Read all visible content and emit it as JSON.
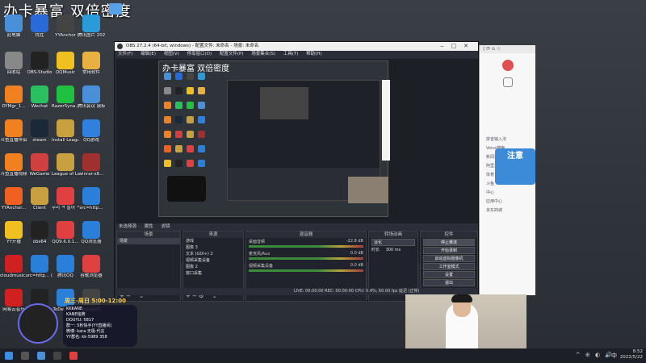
{
  "banner": {
    "text": "办卡暴富 双倍密度"
  },
  "desktop_icons": [
    {
      "label": "此电脑",
      "color": "#4a90d9"
    },
    {
      "label": "找茬",
      "color": "#2a6ad8"
    },
    {
      "label": "YYAnchor",
      "color": "#444"
    },
    {
      "label": "腾讯图片 2022051...",
      "color": "#2a9ad8"
    },
    {
      "label": "回收站",
      "color": "#888"
    },
    {
      "label": "OBS-Studio",
      "color": "#222"
    },
    {
      "label": "QQMusic",
      "color": "#f0c020"
    },
    {
      "label": "常用软件",
      "color": "#e8b040"
    },
    {
      "label": "DYMgr_1...",
      "color": "#f08020"
    },
    {
      "label": "Wechat",
      "color": "#2ac060"
    },
    {
      "label": "RazerSyna...",
      "color": "#20c040"
    },
    {
      "label": "腾讯会议 鼠标点击",
      "color": "#4a90d9"
    },
    {
      "label": "斗鱼直播伴侣",
      "color": "#f08020"
    },
    {
      "label": "steam",
      "color": "#1b2838"
    },
    {
      "label": "Install League...",
      "color": "#c8a040"
    },
    {
      "label": "QQ游戏",
      "color": "#3080e0"
    },
    {
      "label": "斗鱼直播视频",
      "color": "#f08020"
    },
    {
      "label": "WeGame",
      "color": "#d04040"
    },
    {
      "label": "League of Legends",
      "color": "#c8a040"
    },
    {
      "label": "winrar-x6...",
      "color": "#a03030"
    },
    {
      "label": "YYAnchor...",
      "color": "#f06020"
    },
    {
      "label": "Client",
      "color": "#c8a040"
    },
    {
      "label": "우리 ㅋ 들어 ㅋ",
      "color": "#e04040"
    },
    {
      "label": "src=http...",
      "color": "#2a80d8"
    },
    {
      "label": "YY开播",
      "color": "#f0c020"
    },
    {
      "label": "obs64",
      "color": "#222"
    },
    {
      "label": "QQ9.6.0.1...",
      "color": "#e04040"
    },
    {
      "label": "QQ浏览器",
      "color": "#2a80d8"
    },
    {
      "label": "cloudmusic...",
      "color": "#d02020"
    },
    {
      "label": "src=http... (1)",
      "color": "#2a80d8"
    },
    {
      "label": "腾讯QQ",
      "color": "#2a80d8"
    },
    {
      "label": "谷歌浏览器",
      "color": "#e04040"
    },
    {
      "label": "网易云音乐",
      "color": "#d02020"
    },
    {
      "label": "OBS Studio",
      "color": "#222"
    },
    {
      "label": "ToDesk_5...",
      "color": "#2a80d8"
    },
    {
      "label": "kara铭牌",
      "color": "#444"
    }
  ],
  "obs": {
    "title": "OBS 27.2.4 (64-bit, windows) - 配置文件: 未命名 - 场景: 未命名",
    "menu": [
      "文件(F)",
      "编辑(E)",
      "视图(V)",
      "停靠窗口(D)",
      "配置文件(P)",
      "场景集合(S)",
      "工具(T)",
      "帮助(H)"
    ],
    "source_label": "未选择源",
    "properties_label": "属性",
    "filters_label": "滤镜",
    "docks": {
      "scenes": {
        "title": "场景",
        "items": [
          "场景"
        ]
      },
      "sources": {
        "title": "来源",
        "items": [
          "游戏",
          "图像 3",
          "文本 (GDI+) 2",
          "视频采集设备",
          "图像 2",
          "窗口采集"
        ]
      },
      "mixer": {
        "title": "混音器",
        "rows": [
          {
            "name": "桌面音频",
            "db": "-22.8 dB"
          },
          {
            "name": "麦克风/Aux",
            "db": "0.0 dB"
          },
          {
            "name": "视频采集设备",
            "db": "0.0 dB"
          }
        ]
      },
      "transitions": {
        "title": "转场动画",
        "type": "淡化",
        "duration_label": "时长",
        "duration": "300 ms"
      },
      "controls": {
        "title": "控件",
        "buttons": [
          "停止推流",
          "开始录制",
          "启动虚拟摄像机",
          "工作室模式",
          "设置",
          "退出"
        ]
      }
    },
    "status": "LIVE: 00:00:00   REC: 00:00:00   CPU: 0.4%, 60.00 fps   延迟 (正常)"
  },
  "browser": {
    "items": [
      "拼音输入法",
      "Voice搜索",
      "新闻资讯",
      "阿里云",
      "体育",
      "斗鱼",
      "中心",
      "应用中心",
      "京东商城"
    ],
    "assist_text": "注意"
  },
  "overlay": {
    "live_text": "周三-周日 5:00-12:00",
    "lines": [
      "KKKANE",
      "KANE铭牌",
      "DOUYU: 5817",
      "群一: 5秒快手(YY直播间)",
      "微博: kara·无极·代言",
      "YY群名: kk·5989 358"
    ]
  },
  "taskbar": {
    "time": "8:52",
    "date": "2022/5/22",
    "lang": "中",
    "tray_icons": "^ ⊕ ◐ 🔊"
  }
}
